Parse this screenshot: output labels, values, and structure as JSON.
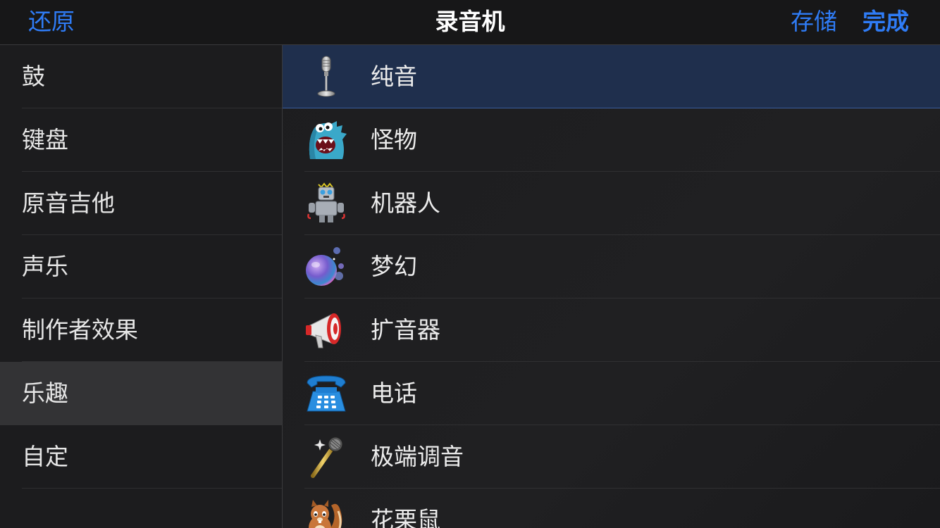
{
  "nav": {
    "revert_label": "还原",
    "title": "录音机",
    "save_label": "存储",
    "done_label": "完成",
    "accent_color": "#2f7cf6"
  },
  "sidebar": {
    "items": [
      {
        "label": "鼓"
      },
      {
        "label": "键盘"
      },
      {
        "label": "原音吉他"
      },
      {
        "label": "声乐"
      },
      {
        "label": "制作者效果"
      },
      {
        "label": "乐趣",
        "selected": true
      },
      {
        "label": "自定"
      }
    ]
  },
  "presets": {
    "items": [
      {
        "label": "纯音",
        "icon": "microphone-icon",
        "selected": true
      },
      {
        "label": "怪物",
        "icon": "monster-icon"
      },
      {
        "label": "机器人",
        "icon": "robot-icon"
      },
      {
        "label": "梦幻",
        "icon": "bubble-icon"
      },
      {
        "label": "扩音器",
        "icon": "megaphone-icon"
      },
      {
        "label": "电话",
        "icon": "telephone-icon"
      },
      {
        "label": "极端调音",
        "icon": "golden-microphone-icon"
      },
      {
        "label": "花栗鼠",
        "icon": "chipmunk-icon"
      }
    ]
  }
}
